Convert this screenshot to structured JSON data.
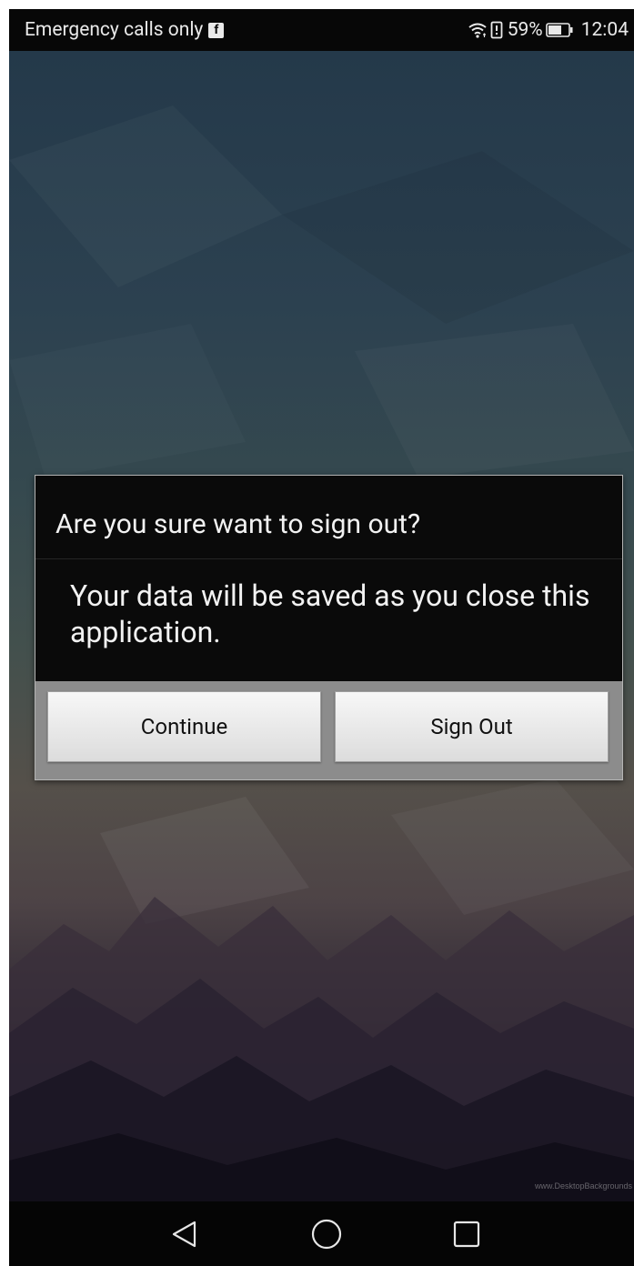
{
  "status_bar": {
    "carrier_text": "Emergency calls only",
    "notification_icon": "facebook-icon",
    "battery_percent": "59%",
    "time": "12:04",
    "icons": [
      "wifi-icon",
      "data-saver-icon",
      "battery-icon"
    ]
  },
  "dialog": {
    "title": "Are you sure want to sign out?",
    "message": "Your data will be saved as you close this application.",
    "buttons": {
      "continue_label": "Continue",
      "sign_out_label": "Sign Out"
    }
  },
  "wallpaper": {
    "watermark": "www.DesktopBackgrounds"
  },
  "nav_bar": {
    "icons": [
      "back-icon",
      "home-icon",
      "recents-icon"
    ]
  },
  "colors": {
    "dialog_background": "#0a0a0a",
    "dialog_button_area": "#8c8c8c",
    "button_face": "#eeeeee",
    "status_bar": "#070707",
    "wallpaper_top": "#24394a",
    "wallpaper_bottom": "#120f1c"
  }
}
